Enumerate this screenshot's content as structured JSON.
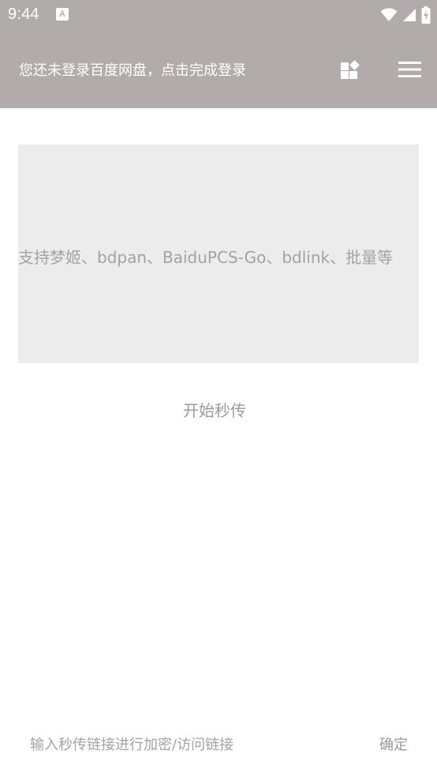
{
  "status_bar": {
    "time": "9:44",
    "notification_icon": "A"
  },
  "app_bar": {
    "title": "您还未登录百度网盘，点击完成登录",
    "apps_icon": "apps-icon",
    "menu_icon": "menu-icon"
  },
  "main": {
    "link_input_placeholder": "支持梦姬、bdpan、BaiduPCS-Go、bdlink、批量等",
    "start_button": "开始秒传"
  },
  "bottom": {
    "encrypt_input_placeholder": "输入秒传链接进行加密/访问链接",
    "confirm_button": "确定"
  },
  "colors": {
    "accent": "#b1abac",
    "input_bg": "#ececec",
    "hint_text": "#a3a3a3"
  }
}
